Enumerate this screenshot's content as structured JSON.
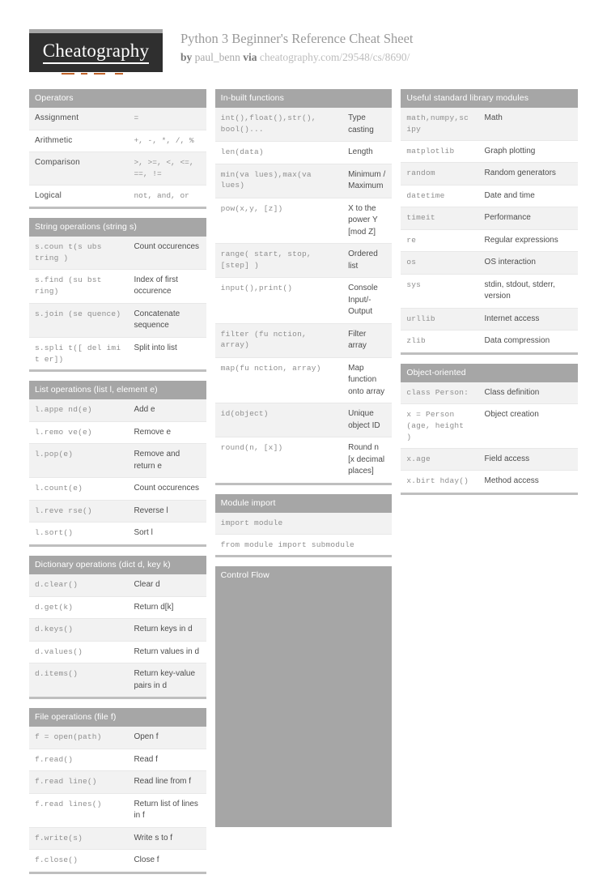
{
  "header": {
    "logo_text": "Cheatography",
    "title": "Python 3 Beginner's Reference Cheat Sheet",
    "by_label": "by",
    "author": "paul_benn",
    "via_label": "via",
    "url": "cheatography.com/29548/cs/8690/"
  },
  "colors": {
    "card_header_bg": "#a6a6a6",
    "row_alt_bg": "#f2f2f2",
    "code_text": "#8e8e8e",
    "desc_text": "#4d4d4d",
    "logo_bg": "#2f2f2f",
    "logo_accent": "#c0632a",
    "card_bottom_border": "#bfbfbf"
  },
  "columns": [
    {
      "cards": [
        {
          "title": "Operators",
          "rows": [
            {
              "code": "Assignment",
              "desc": "=",
              "plain_first": true
            },
            {
              "code": "Arithmetic",
              "desc": "+, -, *, /, %",
              "plain_first": true
            },
            {
              "code": "Comparison",
              "desc": ">, >=, <, <=, ==, !=",
              "plain_first": true
            },
            {
              "code": "Logical",
              "desc": "not, and, or",
              "plain_first": true
            }
          ]
        },
        {
          "title": "String operations (string s)",
          "rows": [
            {
              "code": "s.coun t(s ubs tring )",
              "desc": "Count occurences"
            },
            {
              "code": "s.find (su bst ring)",
              "desc": "Index of first occurence"
            },
            {
              "code": "s.join (se quence)",
              "desc": "Concatenate sequence"
            },
            {
              "code": "s.spli t([ del imi t er])",
              "desc": "Split into list"
            }
          ]
        },
        {
          "title": "List operations (list l, element e)",
          "rows": [
            {
              "code": "l.appe nd(e)",
              "desc": "Add e"
            },
            {
              "code": "l.remo ve(e)",
              "desc": "Remove e"
            },
            {
              "code": "l.pop(e)",
              "desc": "Remove and return e"
            },
            {
              "code": "l.count(e)",
              "desc": "Count occurences"
            },
            {
              "code": "l.reve rse()",
              "desc": "Reverse l"
            },
            {
              "code": "l.sort()",
              "desc": "Sort l"
            }
          ]
        },
        {
          "title": "Dictionary operations (dict d, key k)",
          "rows": [
            {
              "code": "d.clear()",
              "desc": "Clear d"
            },
            {
              "code": "d.get(k)",
              "desc": "Return d[k]"
            },
            {
              "code": "d.keys()",
              "desc": "Return keys in d"
            },
            {
              "code": "d.values()",
              "desc": "Return values in d"
            },
            {
              "code": "d.items()",
              "desc": "Return key-value pairs in d"
            }
          ]
        },
        {
          "title": "File operations (file f)",
          "rows": [
            {
              "code": "f = open(path)",
              "desc": "Open f"
            },
            {
              "code": "f.read()",
              "desc": "Read f"
            },
            {
              "code": "f.read line()",
              "desc": "Read line from f"
            },
            {
              "code": "f.read lines()",
              "desc": "Return list of lines in f"
            },
            {
              "code": "f.write(s)",
              "desc": "Write s to f"
            },
            {
              "code": "f.close()",
              "desc": "Close f"
            }
          ]
        }
      ]
    },
    {
      "cards": [
        {
          "title": "In-built functions",
          "rows": [
            {
              "code": "int(),float(),str(), bool()...",
              "desc": "Type casting"
            },
            {
              "code": "len(data)",
              "desc": "Length"
            },
            {
              "code": "min(va lues),max(va lues)",
              "desc": "Minimum / Maximum"
            },
            {
              "code": "pow(x,y, [z])",
              "desc": "X to the power Y [mod Z]"
            },
            {
              "code": "range( start, stop, [step] )",
              "desc": "Ordered list"
            },
            {
              "code": "input(),print()",
              "desc": "Console Input/-Output"
            },
            {
              "code": "filter (fu nction, array)",
              "desc": "Filter array"
            },
            {
              "code": "map(fu nction, array)",
              "desc": "Map function onto array"
            },
            {
              "code": "id(object)",
              "desc": "Unique object ID"
            },
            {
              "code": "round(n, [x])",
              "desc": "Round n [x decimal places]"
            }
          ]
        },
        {
          "title": "Module import",
          "rows": [
            {
              "code": "import module",
              "desc": "",
              "single": true
            },
            {
              "code": "from module import submodule",
              "desc": "",
              "single": true
            }
          ]
        },
        {
          "title": "Control Flow",
          "rows": [],
          "empty": true,
          "filler_height": 300
        }
      ]
    },
    {
      "cards": [
        {
          "title": "Useful standard library modules",
          "rows": [
            {
              "code": "math,numpy,sc ipy",
              "desc": "Math"
            },
            {
              "code": "matplotlib",
              "desc": "Graph plotting"
            },
            {
              "code": "random",
              "desc": "Random generators"
            },
            {
              "code": "datetime",
              "desc": "Date and time"
            },
            {
              "code": "timeit",
              "desc": "Performance"
            },
            {
              "code": "re",
              "desc": "Regular expressions"
            },
            {
              "code": "os",
              "desc": "OS interaction"
            },
            {
              "code": "sys",
              "desc": "stdin, stdout, stderr, version"
            },
            {
              "code": "urllib",
              "desc": "Internet access"
            },
            {
              "code": "zlib",
              "desc": "Data compression"
            }
          ]
        },
        {
          "title": "Object-oriented",
          "rows": [
            {
              "code": "class Person:",
              "desc": "Class definition"
            },
            {
              "code": "x = Person (age, height )",
              "desc": "Object creation"
            },
            {
              "code": "x.age",
              "desc": "Field access"
            },
            {
              "code": "x.birt hday()",
              "desc": "Method access"
            }
          ]
        }
      ]
    }
  ]
}
